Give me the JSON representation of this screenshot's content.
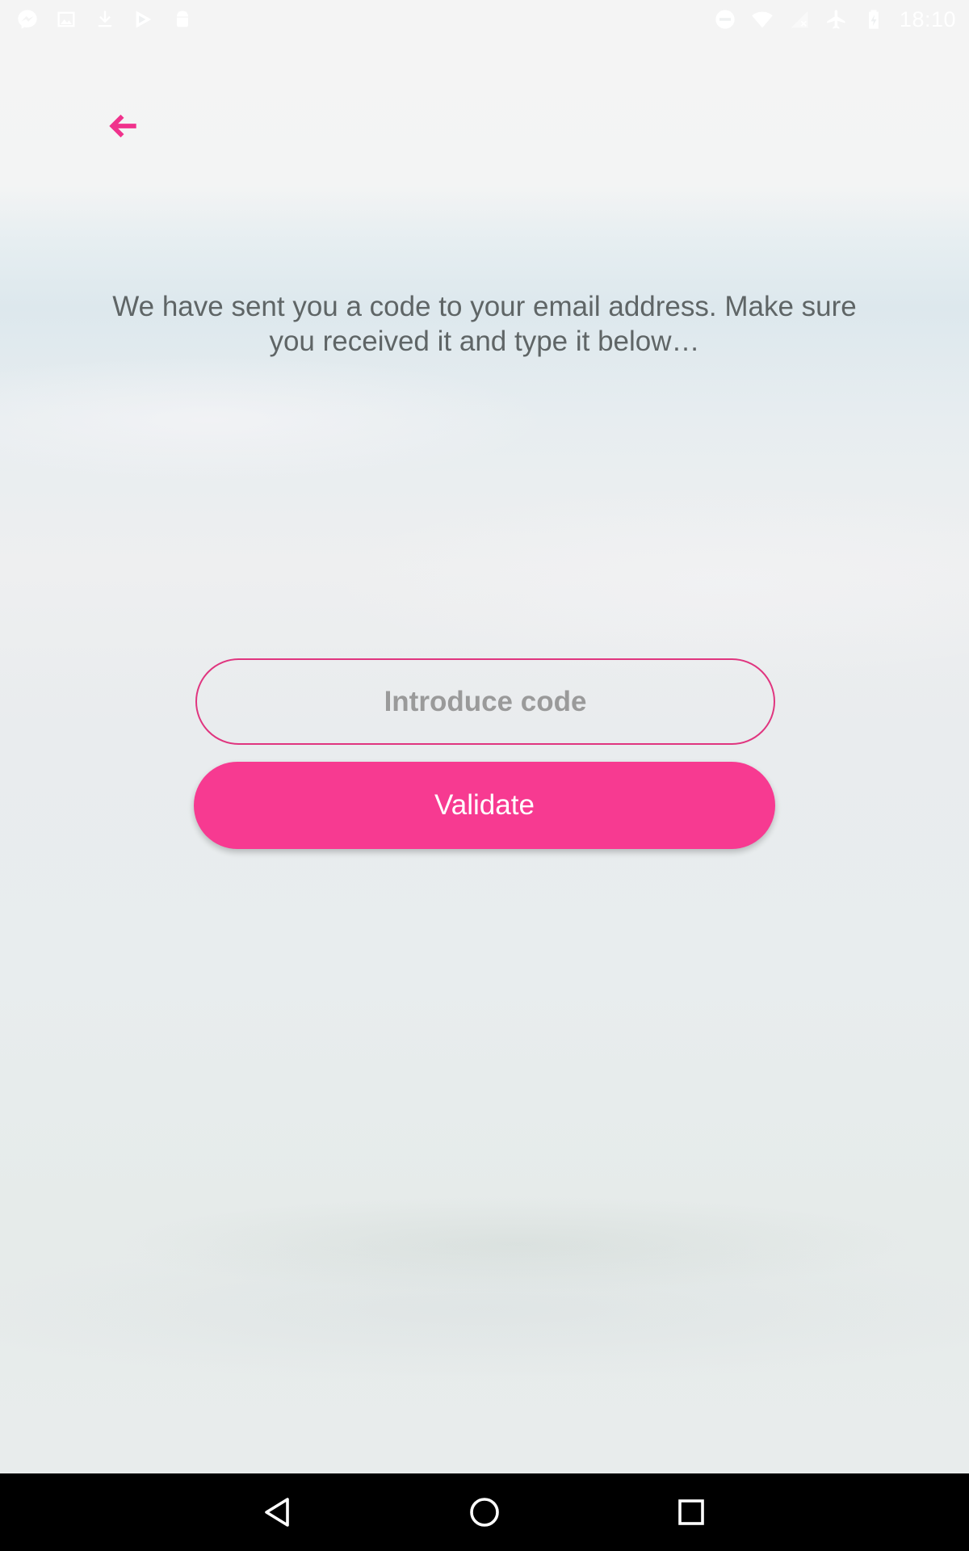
{
  "status_bar": {
    "time": "18:10",
    "left_icons": [
      "messenger-icon",
      "image-icon",
      "download-icon",
      "play-store-icon",
      "android-icon"
    ],
    "right_icons": [
      "do-not-disturb-icon",
      "wifi-icon",
      "no-signal-icon",
      "airplane-mode-icon",
      "battery-charging-icon"
    ]
  },
  "header": {
    "back_icon": "arrow-left-icon"
  },
  "main": {
    "message": "We have sent you a code to your email address. Make sure you received it and type it below…",
    "code_input": {
      "value": "",
      "placeholder": "Introduce code"
    },
    "validate_label": "Validate"
  },
  "nav_bar": {
    "icons": [
      "nav-back-icon",
      "nav-home-icon",
      "nav-recents-icon"
    ]
  },
  "colors": {
    "accent": "#f73a91",
    "input_border": "#e0357f",
    "message_text": "#5f6566",
    "placeholder": "#9a9a9a"
  }
}
